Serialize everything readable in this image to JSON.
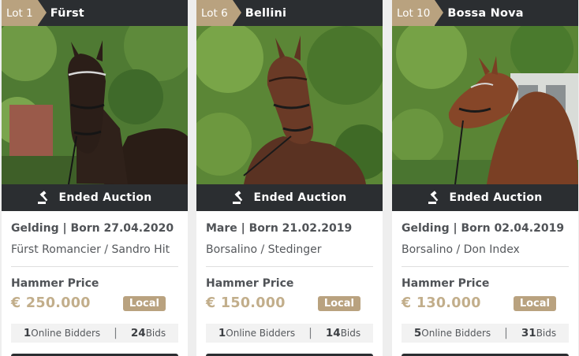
{
  "section": {
    "ended_label": "Ended Auction",
    "price_label": "Hammer Price",
    "badge_label": "Local",
    "online_bidders_label": "Online Bidders",
    "bids_label": "Bids",
    "bids_separator": "|"
  },
  "lots": [
    {
      "lot": "Lot 1",
      "name": "Fürst",
      "meta": "Gelding | Born 27.04.2020",
      "pedigree": "Fürst Romancier / Sandro Hit",
      "price": "€ 250.000",
      "online_bidders": "1",
      "bids": "24",
      "photo_icon": "horse-photo-dark-bay"
    },
    {
      "lot": "Lot 6",
      "name": "Bellini",
      "meta": "Mare | Born 21.02.2019",
      "pedigree": "Borsalino / Stedinger",
      "price": "€ 150.000",
      "online_bidders": "1",
      "bids": "14",
      "photo_icon": "horse-photo-bay"
    },
    {
      "lot": "Lot 10",
      "name": "Bossa Nova",
      "meta": "Gelding | Born 02.04.2019",
      "pedigree": "Borsalino / Don Index",
      "price": "€ 130.000",
      "online_bidders": "5",
      "bids": "31",
      "photo_icon": "horse-photo-chestnut-bay"
    }
  ],
  "colors": {
    "accent_gold": "#b9a27f",
    "price_gold": "#c2ae8b",
    "dark_bar": "#2b2e31",
    "page_background": "#eeeeee"
  }
}
